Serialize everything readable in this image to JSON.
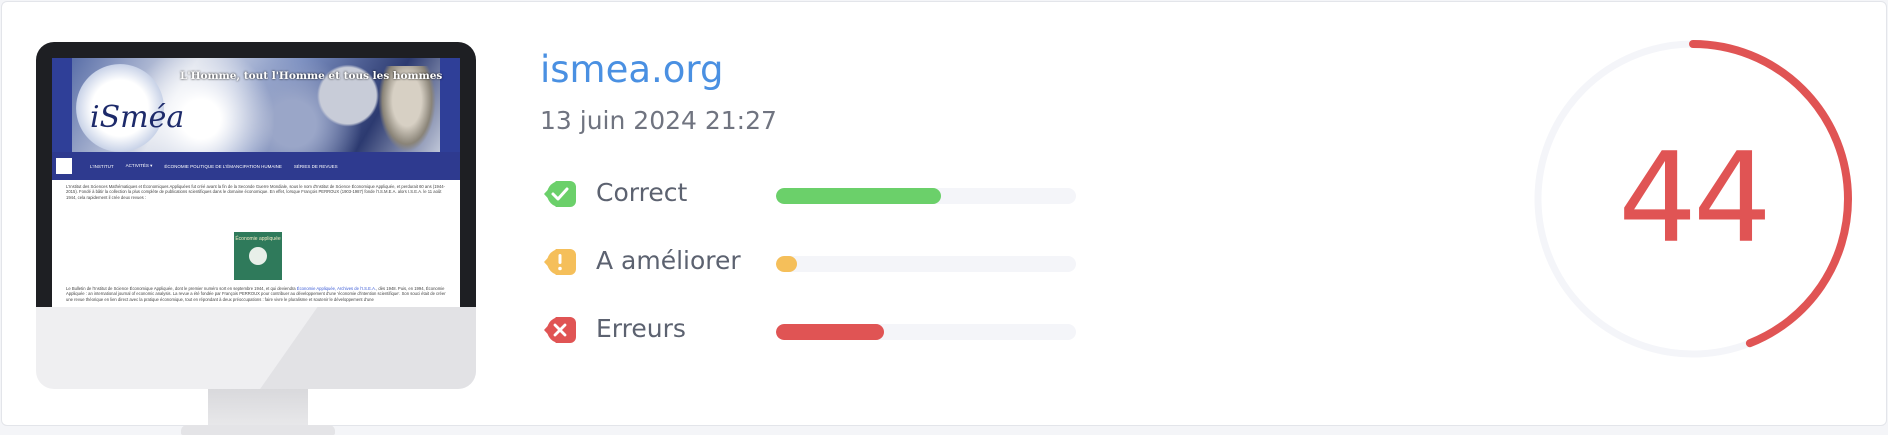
{
  "site": {
    "domain": "ismea.org",
    "date": "13 juin 2024 21:27"
  },
  "preview": {
    "slogan": "L'Homme, tout l'Homme et tous les hommes",
    "logo_text": "iSméa",
    "nav": [
      "L'INSTITUT",
      "ACTIVITÉS ▾",
      "ÉCONOMIE POLITIQUE DE L'ÉMANCIPATION HUMAINE",
      "SÉRIES DE REVUES"
    ],
    "body_text": "L'Institut des Sciences Mathématiques et Économiques Appliquées fut créé avant la fin de la Seconde Guerre Mondiale, sous le nom d'Institut de Science Économique Appliquée, et perdurait 60 ans (1944-2015). Fondé à bâtir la collection la plus complète de publications scientifiques dans le domaine économique. En effet, lorsque François PERROUX (1903-1987) fonde l'I.S.M.E.A. alors I.S.E.A. le 11 août 1944, cela rapidement il crée deux revues :",
    "book_title": "Économie appliquée",
    "body_text2_a": "Le Bulletin de l'Institut de Science Économique Appliquée, dont le premier numéro sort en septembre 1944, et qui deviendra ",
    "body_text2_link": "Économie Appliquée, Archives de l'I.S.E.A.",
    "body_text2_b": ", dès 1948. Puis, en 1994, Économie Appliquée : an international journal of economic analysis. La revue a été fondée par François PERROUX pour contribuer au développement d'une 'économie d'intention scientifique'. Son souci était de créer une revue théorique en lien direct avec la pratique économique, tout en répondant à deux préoccupations : faire vivre le pluralisme et soutenir le développement d'une"
  },
  "metrics": [
    {
      "key": "correct",
      "label": "Correct",
      "value": 0.55,
      "color": "#6bd06a",
      "icon": "check-icon"
    },
    {
      "key": "improve",
      "label": "A améliorer",
      "value": 0.07,
      "color": "#f5bf5a",
      "icon": "exclamation-icon"
    },
    {
      "key": "errors",
      "label": "Erreurs",
      "value": 0.36,
      "color": "#e05454",
      "icon": "cross-icon"
    }
  ],
  "score": {
    "value": "44",
    "fraction": 0.44,
    "color": "#e05454",
    "track_color": "#f4f5f9"
  }
}
